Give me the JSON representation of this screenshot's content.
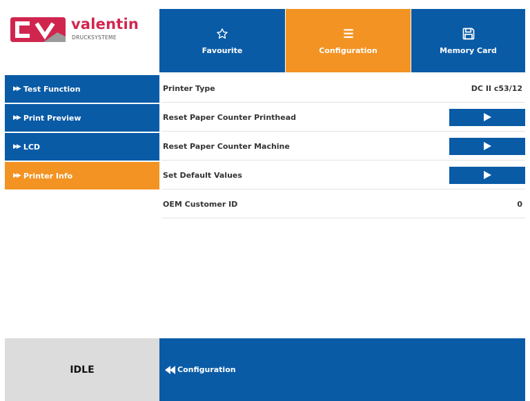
{
  "logo": {
    "brand": "valentin",
    "subtitle": "DRUCKSYSTEME",
    "colors": {
      "mark": "#d0264e",
      "text": "#d0264e"
    }
  },
  "tabs": [
    {
      "label": "Favourite",
      "icon": "star-icon",
      "active": false
    },
    {
      "label": "Configuration",
      "icon": "list-icon",
      "active": true
    },
    {
      "label": "Memory Card",
      "icon": "save-icon",
      "active": false
    }
  ],
  "sidebar": {
    "items": [
      {
        "label": "Test Function",
        "active": false
      },
      {
        "label": "Print Preview",
        "active": false
      },
      {
        "label": "LCD",
        "active": false
      },
      {
        "label": "Printer Info",
        "active": true
      }
    ]
  },
  "rows": [
    {
      "label": "Printer Type",
      "value": "DC II c53/12"
    },
    {
      "label": "Reset Paper Counter Printhead",
      "action": "play-icon"
    },
    {
      "label": "Reset Paper Counter Machine",
      "action": "play-icon"
    },
    {
      "label": "Set Default Values",
      "action": "play-icon"
    },
    {
      "label": "OEM Customer ID",
      "value": "0"
    }
  ],
  "footer": {
    "status": "IDLE",
    "back_label": "Configuration",
    "back_icon": "double-chevron-left-icon"
  },
  "colors": {
    "blue": "#0a5ba6",
    "orange": "#f39323",
    "status_bg": "#dcdcdc"
  }
}
